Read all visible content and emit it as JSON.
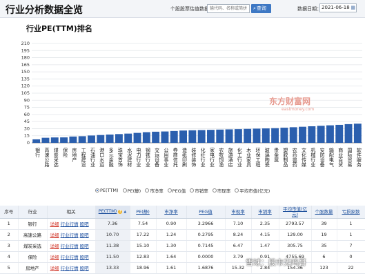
{
  "header": {
    "title": "行业分析数据全览",
    "stock_query_label": "个股股票估值数据：",
    "search_placeholder": "输代码、名称或简拼",
    "query_button": "查询",
    "date_label": "数据日期：",
    "date_value": "2021-06-18"
  },
  "watermark": {
    "brand": "东方财富网",
    "domain": "eastmoney.com"
  },
  "chart_data": {
    "type": "bar",
    "title": "行业PE(TTM)排名",
    "ylim": [
      0,
      210
    ],
    "yticks": [
      0,
      15,
      30,
      45,
      60,
      75,
      90,
      105,
      120,
      135,
      150,
      165,
      180,
      195,
      210
    ],
    "grid": true,
    "bar_color": "#2b5fae",
    "categories": [
      "银行",
      "高速公路",
      "煤炭采选",
      "保险",
      "房地产",
      "工程建设",
      "石油行业",
      "港口水运",
      "多元金融",
      "珠宝首饰",
      "水泥建材",
      "电力行业",
      "钢铁行业",
      "交运设备",
      "公用事业",
      "券商信托",
      "造纸印刷",
      "装修装饰",
      "化纤行业",
      "家电行业",
      "农牧饲渔",
      "旅游酒店",
      "化工行业",
      "木业家具",
      "环保工程",
      "玻璃陶瓷",
      "贵金属",
      "塑胶制品",
      "农药兽药",
      "文化传媒",
      "机械行业",
      "安防设备",
      "输配电气",
      "商业百货",
      "国际贸易",
      "软件服务"
    ],
    "values": [
      7.36,
      10.7,
      11.38,
      11.5,
      13.33,
      14,
      15.5,
      16.5,
      17.5,
      18.5,
      19.5,
      21,
      22.5,
      23.5,
      24,
      25,
      26,
      26.5,
      27,
      27.5,
      28,
      28.5,
      29,
      29.5,
      30,
      30.5,
      31,
      32,
      33,
      34,
      35,
      36,
      37,
      38,
      39.5,
      40.5
    ]
  },
  "legend": {
    "options": [
      "PE(TTM)",
      "PE(静)",
      "市净率",
      "PEG值",
      "市销率",
      "市现率",
      "平均市值(亿元)"
    ],
    "selected": "PE(TTM)"
  },
  "table": {
    "headers": [
      "序号",
      "行业",
      "相关",
      "PE(TTM)",
      "PE(静)",
      "市净率",
      "PEG值",
      "市现率",
      "市销率",
      "平均市值(亿元)",
      "个股数量",
      "亏损家数"
    ],
    "link_labels": [
      "详细",
      "行业行情",
      "股吧"
    ],
    "rows": [
      [
        "1",
        "银行",
        "7.36",
        "7.54",
        "0.90",
        "3.2966",
        "7.10",
        "2.35",
        "2793.57",
        "39",
        "1"
      ],
      [
        "2",
        "高速公路",
        "10.70",
        "17.22",
        "1.24",
        "0.2795",
        "8.24",
        "4.15",
        "129.00",
        "19",
        "1"
      ],
      [
        "3",
        "煤炭采选",
        "11.38",
        "15.10",
        "1.30",
        "0.7145",
        "6.47",
        "1.47",
        "305.75",
        "35",
        "7"
      ],
      [
        "4",
        "保险",
        "11.50",
        "12.83",
        "1.64",
        "0.0000",
        "3.79",
        "0.91",
        "4755.69",
        "6",
        "0"
      ],
      [
        "5",
        "房地产",
        "13.33",
        "18.96",
        "1.61",
        "1.6876",
        "15.32",
        "2.84",
        "154.36",
        "123",
        "22"
      ]
    ]
  },
  "footer_watermark": "雪球：股市无鸣哥"
}
